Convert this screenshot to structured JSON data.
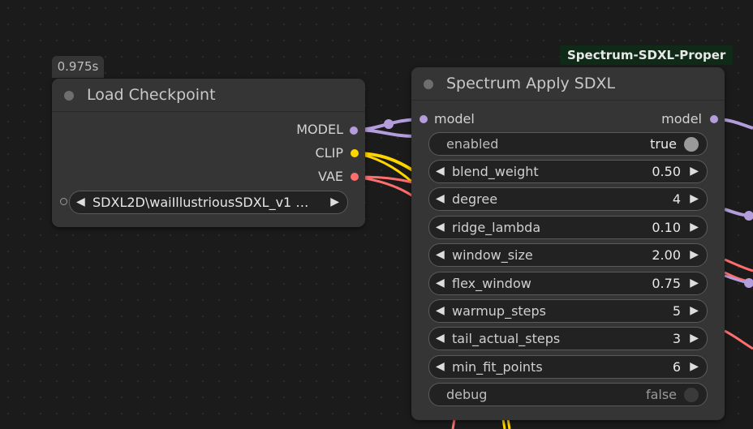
{
  "badges": {
    "time": "0.975s",
    "source": "Spectrum-SDXL-Proper"
  },
  "load_checkpoint": {
    "title": "Load Checkpoint",
    "outputs": [
      {
        "label": "MODEL",
        "color": "#b39ddb"
      },
      {
        "label": "CLIP",
        "color": "#ffd500"
      },
      {
        "label": "VAE",
        "color": "#ff6e6e"
      }
    ],
    "ckpt_value": "SDXL2D\\waiIllustriousSDXL_v1 …"
  },
  "spectrum": {
    "title": "Spectrum Apply SDXL",
    "input_label": "model",
    "output_label": "model",
    "enabled": {
      "name": "enabled",
      "value": "true"
    },
    "widgets": [
      {
        "name": "blend_weight",
        "value": "0.50"
      },
      {
        "name": "degree",
        "value": "4"
      },
      {
        "name": "ridge_lambda",
        "value": "0.10"
      },
      {
        "name": "window_size",
        "value": "2.00"
      },
      {
        "name": "flex_window",
        "value": "0.75"
      },
      {
        "name": "warmup_steps",
        "value": "5"
      },
      {
        "name": "tail_actual_steps",
        "value": "3"
      },
      {
        "name": "min_fit_points",
        "value": "6"
      }
    ],
    "debug": {
      "name": "debug",
      "value": "false"
    }
  },
  "colors": {
    "model": "#b39ddb",
    "clip": "#ffd500",
    "vae": "#ff6e6e",
    "node_bg": "#353535",
    "canvas_bg": "#1b1b1b"
  },
  "icons": {
    "arrow_left": "◀",
    "arrow_right": "▶"
  }
}
